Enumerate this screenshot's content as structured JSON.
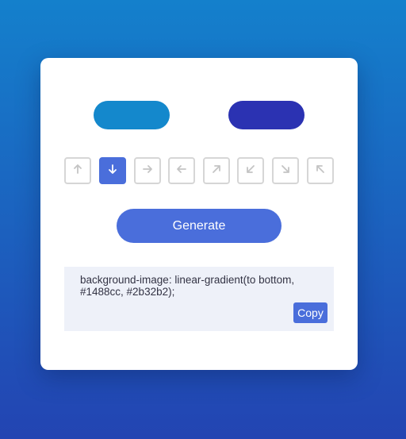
{
  "page": {
    "background_from": "#1480cc",
    "background_to": "#2344b2"
  },
  "colors": {
    "color_1": "#1488cc",
    "color_2": "#2b32b2",
    "accent": "#4a6edb"
  },
  "directions": [
    {
      "name": "arrow-up-icon",
      "active": false
    },
    {
      "name": "arrow-down-icon",
      "active": true
    },
    {
      "name": "arrow-right-icon",
      "active": false
    },
    {
      "name": "arrow-left-icon",
      "active": false
    },
    {
      "name": "arrow-up-right-icon",
      "active": false
    },
    {
      "name": "arrow-down-left-icon",
      "active": false
    },
    {
      "name": "arrow-down-right-icon",
      "active": false
    },
    {
      "name": "arrow-up-left-icon",
      "active": false
    }
  ],
  "generate_label": "Generate",
  "output": {
    "code": "background-image: linear-gradient(to bottom, #1488cc, #2b32b2);",
    "copy_label": "Copy"
  }
}
